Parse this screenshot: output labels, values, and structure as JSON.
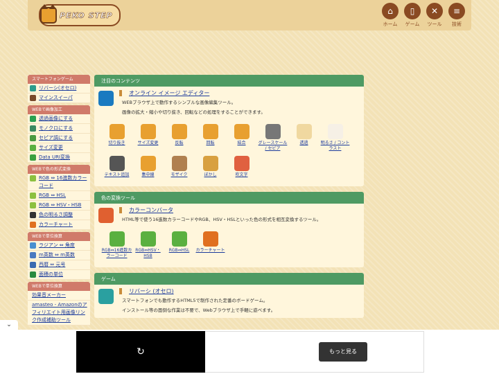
{
  "header": {
    "logo_text": "PEKO STEP",
    "nav": [
      {
        "label": "ホーム",
        "icon": "home-icon",
        "glyph": "⌂"
      },
      {
        "label": "ゲーム",
        "icon": "phone-icon",
        "glyph": "▯"
      },
      {
        "label": "ツール",
        "icon": "tools-icon",
        "glyph": "✕"
      },
      {
        "label": "技術",
        "icon": "document-icon",
        "glyph": "≡"
      }
    ]
  },
  "sidebar": [
    {
      "title": "スマートフォンゲーム",
      "items": [
        {
          "label": "リバーシ(オセロ)",
          "color": "#2c9c8c"
        },
        {
          "label": "マインスイーパ",
          "color": "#7a4a2a"
        }
      ]
    },
    {
      "title": "WEBで画像加工",
      "items": [
        {
          "label": "透過画像にする",
          "color": "#2aa050"
        },
        {
          "label": "モノクロにする",
          "color": "#3a8a60"
        },
        {
          "label": "セピア調にする",
          "color": "#4a9a40"
        },
        {
          "label": "サイズ変更",
          "color": "#5ab040"
        },
        {
          "label": "Data URI変換",
          "color": "#3aa040"
        }
      ]
    },
    {
      "title": "WEBで色の形式変換",
      "items": [
        {
          "label": "RGB ⇔ 16進数カラーコード",
          "color": "#8cc040"
        },
        {
          "label": "RGB ⇔ HSL",
          "color": "#8cc040"
        },
        {
          "label": "RGB ⇔ HSV・HSB",
          "color": "#8cc040"
        },
        {
          "label": "色の明るさ調整",
          "color": "#333333"
        },
        {
          "label": "カラーチャート",
          "color": "#e07020"
        }
      ]
    },
    {
      "title": "WEBで単位換算",
      "items": [
        {
          "label": "ラジアン ⇔ 角度",
          "color": "#4a90d0"
        },
        {
          "label": "m英数 ⇔ m英数",
          "color": "#4a7ac0"
        },
        {
          "label": "西暦 ⇔ 元号",
          "color": "#3a6ab0"
        },
        {
          "label": "面積の単位",
          "color": "#2a8a40"
        }
      ]
    },
    {
      "title": "WEBで単位換算",
      "items": [
        {
          "label": "効果音メーカー",
          "color": ""
        },
        {
          "label": "amasteo - Amazonのアフィリエイト用画像リンク作成補助ツール",
          "color": ""
        }
      ]
    }
  ],
  "cards": [
    {
      "header": "注目のコンテンツ",
      "title": "オンライン イメージ エディター",
      "desc": [
        "WEBブラウザ上で動作するシンプルな画像編集ツール。",
        "画像の拡大・縮小や切り抜き、回転などの処理をすることができます。"
      ],
      "tools": [
        {
          "label": "切り抜き",
          "color": "#e8a030"
        },
        {
          "label": "サイズ変更",
          "color": "#e8a030"
        },
        {
          "label": "反転",
          "color": "#e8a030"
        },
        {
          "label": "回転",
          "color": "#e8a030"
        },
        {
          "label": "結合",
          "color": "#e8a030"
        },
        {
          "label": "グレースケール / セピア",
          "color": "#777777"
        },
        {
          "label": "透過",
          "color": "#f0d8a0"
        },
        {
          "label": "明るさ / コントラスト",
          "color": "#f6f0e6"
        },
        {
          "label": "テキスト追加",
          "color": "#555555"
        },
        {
          "label": "集中線",
          "color": "#e8a030"
        },
        {
          "label": "モザイク",
          "color": "#b08050"
        },
        {
          "label": "ぼかし",
          "color": "#d8a040"
        },
        {
          "label": "吹文字",
          "color": "#e06040"
        }
      ]
    },
    {
      "header": "色の変換ツール",
      "title": "カラーコンバータ",
      "desc": [
        "HTML等で使う16進数カラーコードやRGB、HSV・HSLといった色の形式を相互変換するツール。"
      ],
      "tools": [
        {
          "label": "RGB⇔16進数カラーコード",
          "color": "#5ab040"
        },
        {
          "label": "RGB⇔HSV・HSB",
          "color": "#5ab040"
        },
        {
          "label": "RGB⇔HSL",
          "color": "#5ab040"
        },
        {
          "label": "カラーチャート",
          "color": "#e07020"
        }
      ]
    },
    {
      "header": "ゲーム",
      "title": "リバーシ (オセロ)",
      "desc": [
        "スマートフォンでも動作するHTML5で制作された定番のボードゲーム。",
        "インストール等の面倒な作業は不要で、Webブラウザ上で手軽に遊べます。"
      ],
      "tools": []
    }
  ],
  "ad": {
    "more_label": "もっと見る",
    "replay_glyph": "↻",
    "chev": "⌄"
  }
}
